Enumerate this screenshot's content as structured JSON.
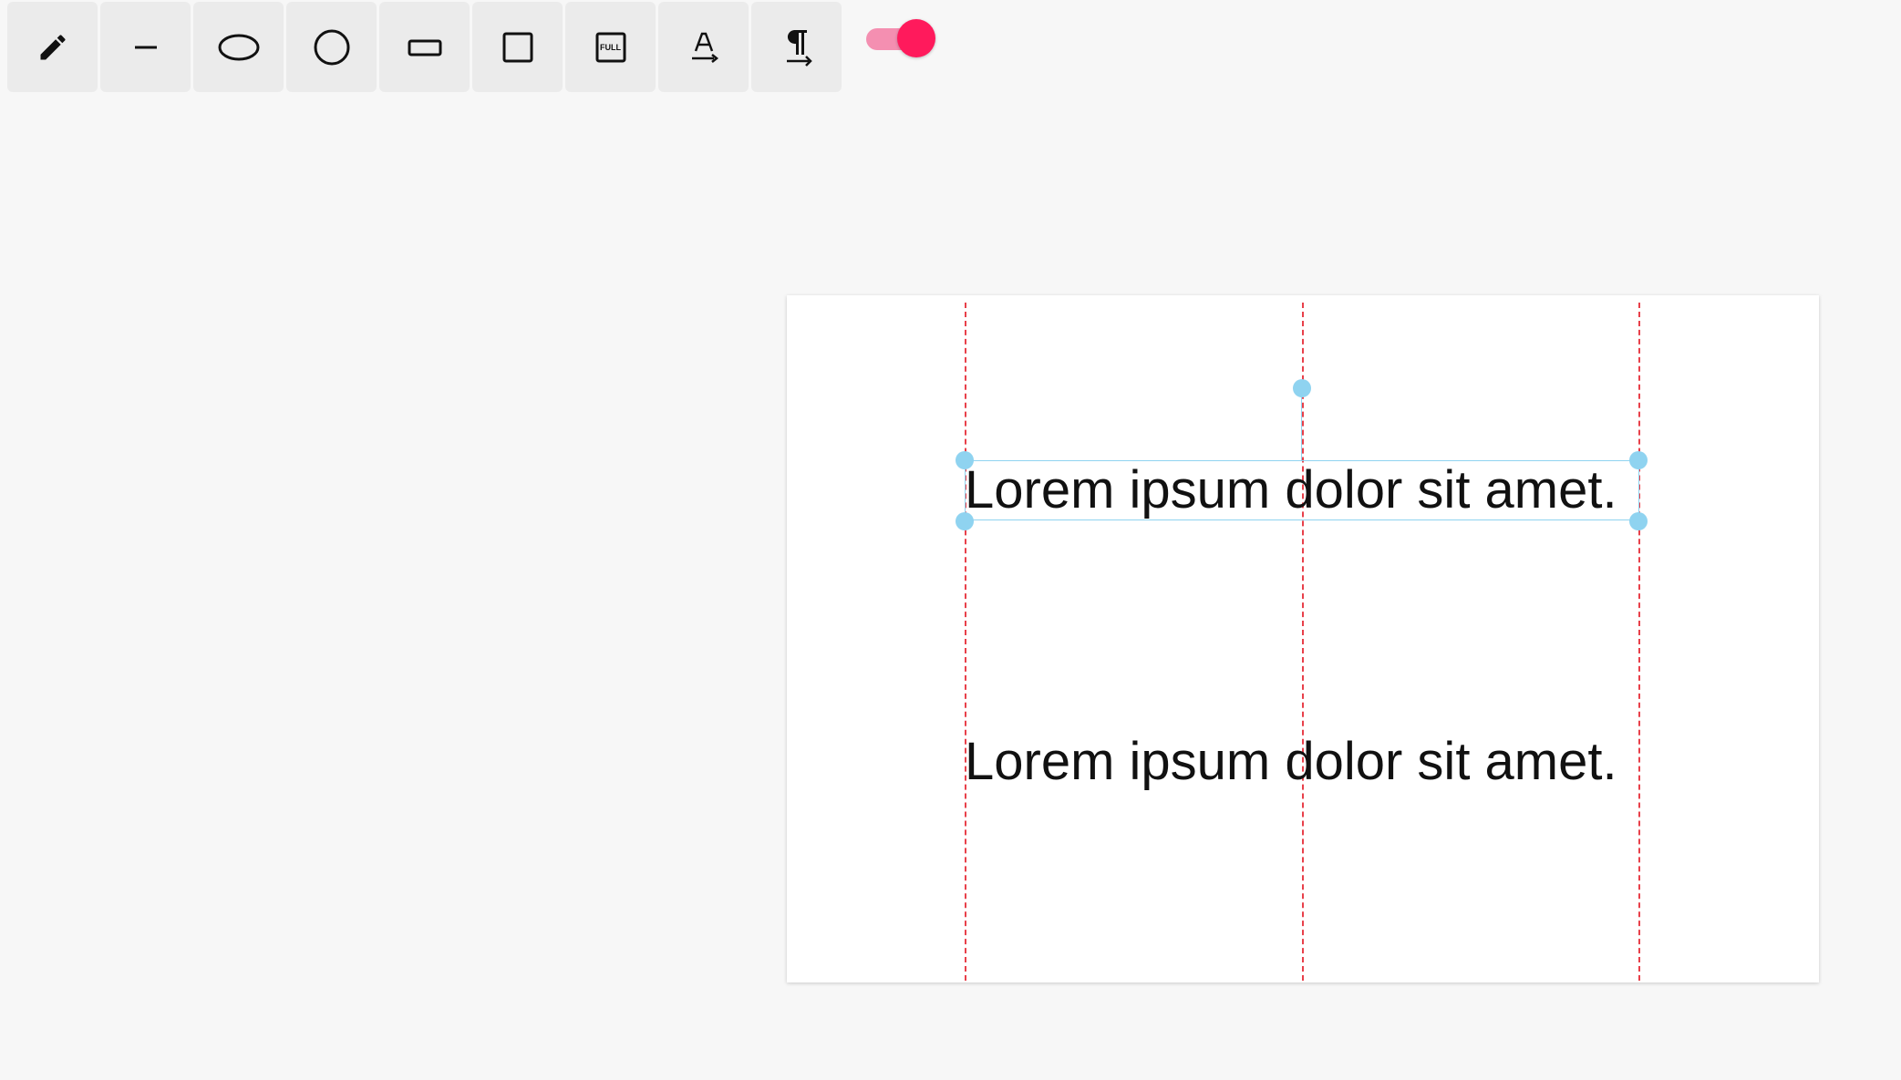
{
  "toolbar": {
    "tools": [
      {
        "icon": "pencil-icon",
        "label": "Freehand"
      },
      {
        "icon": "line-icon",
        "label": "Line"
      },
      {
        "icon": "ellipse-icon",
        "label": "Ellipse"
      },
      {
        "icon": "circle-icon",
        "label": "Circle"
      },
      {
        "icon": "rectangle-icon",
        "label": "Rectangle"
      },
      {
        "icon": "square-icon",
        "label": "Square"
      },
      {
        "icon": "full-icon",
        "label": "FULL"
      },
      {
        "icon": "text-icon",
        "label": "Text"
      },
      {
        "icon": "paragraph-icon",
        "label": "Paragraph"
      }
    ],
    "full_label": "FULL",
    "toggle_on": true,
    "toggle_color": "#ff1a5c"
  },
  "canvas": {
    "text_1": "Lorem ipsum dolor sit amet.",
    "text_2": "Lorem ipsum dolor sit amet.",
    "guide_color": "#e8404a",
    "selection_color": "#8fd3f0"
  }
}
